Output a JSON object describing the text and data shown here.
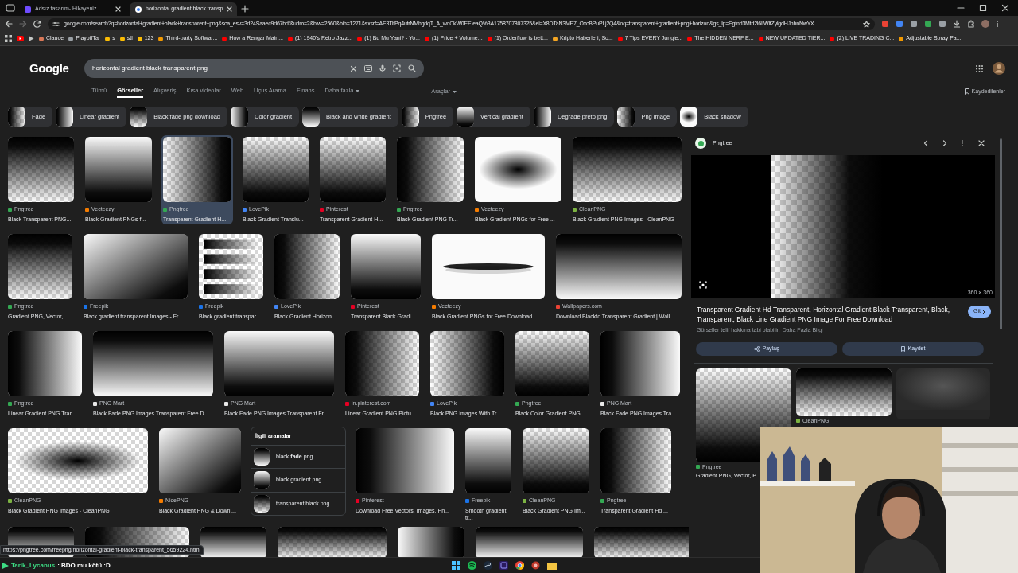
{
  "browser": {
    "tabs": [
      {
        "title": "Adsız tasarım- Hikayeniz",
        "selected": false
      },
      {
        "title": "horizontal gradient black transp",
        "selected": true
      }
    ],
    "url": "google.com/search?q=horizontal+gradient+black+transparent+png&sca_esv=3d24Saaec9d67bdf&udm=2&biw=2560&bih=1271&sxsrf=AE3TifPq4utrNMhgdqT_A_woCkW0EEIeaQ%3A1758707807325&ei=X8DTaN3ME7_OxcBPuPLj2Q4&oq=transparent+gradient+png+horizon&gs_lp=Egtnd3Mtd2l6LWltZylgdHJhbnNwYX...",
    "bookmarks": [
      {
        "label": "Claude",
        "color": "#d97757"
      },
      {
        "label": "PlayoffTar",
        "color": "#9aa0a6"
      },
      {
        "label": "s",
        "color": "#fbbc04"
      },
      {
        "label": "stl",
        "color": "#fbbc04"
      },
      {
        "label": "123",
        "color": "#fbbc04"
      },
      {
        "label": "Third-party Softwar...",
        "color": "#f29900"
      },
      {
        "label": "How a Rengar Main...",
        "color": "#ff0000"
      },
      {
        "label": "(1) 1940's Retro Jazz...",
        "color": "#ff0000"
      },
      {
        "label": "(1) Bu Mu Yani? - Yo...",
        "color": "#ff0000"
      },
      {
        "label": "(1) Price + Volume...",
        "color": "#ff0000"
      },
      {
        "label": "(1) Orderflow is bett...",
        "color": "#ff0000"
      },
      {
        "label": "Kripto Haberleri, So...",
        "color": "#f5a623"
      },
      {
        "label": "7 Tips EVERY Jungle...",
        "color": "#ff0000"
      },
      {
        "label": "The HIDDEN NERF E...",
        "color": "#ff0000"
      },
      {
        "label": "NEW UPDATED TIER...",
        "color": "#ff0000"
      },
      {
        "label": "(2) LIVE TRADING C...",
        "color": "#ff0000"
      },
      {
        "label": "Adjustable Spray Pa...",
        "color": "#f29900"
      }
    ]
  },
  "search": {
    "logo": "Google",
    "query": "horizontal gradient black transparent png",
    "nav": [
      {
        "label": "Tümü",
        "selected": false
      },
      {
        "label": "Görseller",
        "selected": true
      },
      {
        "label": "Alışveriş",
        "selected": false
      },
      {
        "label": "Kısa videolar",
        "selected": false
      },
      {
        "label": "Web",
        "selected": false
      },
      {
        "label": "Uçuş Arama",
        "selected": false
      },
      {
        "label": "Finans",
        "selected": false
      },
      {
        "label": "Daha fazla",
        "selected": false
      }
    ],
    "tools": "Araçlar",
    "saved": "Kaydedilenler"
  },
  "chips": [
    "Fade",
    "Linear gradient",
    "Black fade png download",
    "Color gradient",
    "Black and white gradient",
    "Pngtree",
    "Vertical gradient",
    "Degrade preto png",
    "Png image",
    "Black shadow"
  ],
  "results": [
    [
      {
        "source": "Pngtree",
        "color": "#34a853",
        "title": "Black Transparent PNG...",
        "selected": false
      },
      {
        "source": "Vecteezy",
        "color": "#f57c00",
        "title": "Black Gradient PNGs f...",
        "selected": false
      },
      {
        "source": "Pngtree",
        "color": "#34a853",
        "title": "Transparent Gradient H...",
        "selected": true
      },
      {
        "source": "LovePik",
        "color": "#4285f4",
        "title": "Black Gradient Translu...",
        "selected": false
      },
      {
        "source": "Pinterest",
        "color": "#e60023",
        "title": "Transparent Gradient H...",
        "selected": false
      },
      {
        "source": "Pngtree",
        "color": "#34a853",
        "title": "Black Gradient PNG Tr...",
        "selected": false
      },
      {
        "source": "Vecteezy",
        "color": "#f57c00",
        "title": "Black Gradient PNGs for Free ...",
        "selected": false
      },
      {
        "source": "CleanPNG",
        "color": "#7cb342",
        "title": "Black Gradient PNG Images - CleanPNG",
        "selected": false
      }
    ],
    [
      {
        "source": "Pngtree",
        "color": "#34a853",
        "title": "Gradient PNG, Vector, ...",
        "selected": false
      },
      {
        "source": "Freepik",
        "color": "#1a73e8",
        "title": "Black gradient transparent Images - Fr...",
        "selected": false
      },
      {
        "source": "Freepik",
        "color": "#1a73e8",
        "title": "Black gradient transpar...",
        "selected": false
      },
      {
        "source": "LovePik",
        "color": "#4285f4",
        "title": "Black Gradient Horizon...",
        "selected": false
      },
      {
        "source": "Pinterest",
        "color": "#e60023",
        "title": "Transparent Black Gradi...",
        "selected": false
      },
      {
        "source": "Vecteezy",
        "color": "#f57c00",
        "title": "Black Gradient PNGs for Free Download",
        "selected": false
      },
      {
        "source": "Wallpapers.com",
        "color": "#ea4335",
        "title": "Download Blackto Transparent Gradient | Wall...",
        "selected": false
      }
    ],
    [
      {
        "source": "Pngtree",
        "color": "#34a853",
        "title": "Linear Gradient PNG Tran...",
        "selected": false
      },
      {
        "source": "PNG Mart",
        "color": "#e8e8e8",
        "title": "Black Fade PNG Images Transparent Free D...",
        "selected": false
      },
      {
        "source": "PNG Mart",
        "color": "#e8e8e8",
        "title": "Black Fade PNG Images Transparent Fr...",
        "selected": false
      },
      {
        "source": "in.pinterest.com",
        "color": "#e60023",
        "title": "Linear Gradient PNG Pictu...",
        "selected": false
      },
      {
        "source": "LovePik",
        "color": "#4285f4",
        "title": "Black PNG Images With Tr...",
        "selected": false
      },
      {
        "source": "Pngtree",
        "color": "#34a853",
        "title": "Black Color Gradient PNG...",
        "selected": false
      },
      {
        "source": "PNG Mart",
        "color": "#e8e8e8",
        "title": "Black Fade PNG Images Tra...",
        "selected": false
      }
    ],
    [
      {
        "source": "CleanPNG",
        "color": "#7cb342",
        "title": "Black Gradient PNG Images - CleanPNG",
        "selected": false
      },
      {
        "source": "NicePNG",
        "color": "#f57c00",
        "title": "Black Gradient PNG & Downl...",
        "selected": false
      },
      {
        "kind": "related",
        "title": "İlgili aramalar",
        "items": [
          "black **fade** png",
          "black gradient png",
          "transparent black png"
        ]
      },
      {
        "source": "Pinterest",
        "color": "#e60023",
        "title": "Download Free Vectors, Images, Ph...",
        "selected": false
      },
      {
        "source": "Freepik",
        "color": "#1a73e8",
        "title": "Smooth gradient tr...",
        "selected": false
      },
      {
        "source": "CleanPNG",
        "color": "#7cb342",
        "title": "Black Gradient PNG Im...",
        "selected": false
      },
      {
        "source": "Pngtree",
        "color": "#34a853",
        "title": "Transparent Gradient Hd ...",
        "selected": false
      }
    ]
  ],
  "preview": {
    "source": "Pngtree",
    "size": "360 × 360",
    "title": "Transparent Gradient Hd Transparent, Horizontal Gradient Black Transparent, Black, Transparent, Black Line Gradient PNG Image For Free Download",
    "visit": "Git",
    "note": "Görseller telif hakkına tabi olabilir.",
    "note_link": "Daha Fazla Bilgi",
    "share": "Paylaş",
    "save": "Kaydet",
    "related": [
      {
        "source": "Pngtree",
        "color": "#34a853",
        "title": "Gradient PNG, Vector, P"
      },
      {
        "source": "CleanPNG",
        "color": "#7cb342"
      }
    ]
  },
  "status_url": "https://pngtree.com/freepng/horizontal-gradient-black-transparent_5659224.html",
  "chat": {
    "user": "Tarik_Lycanus",
    "message": ": BDO mu kötü :D"
  }
}
